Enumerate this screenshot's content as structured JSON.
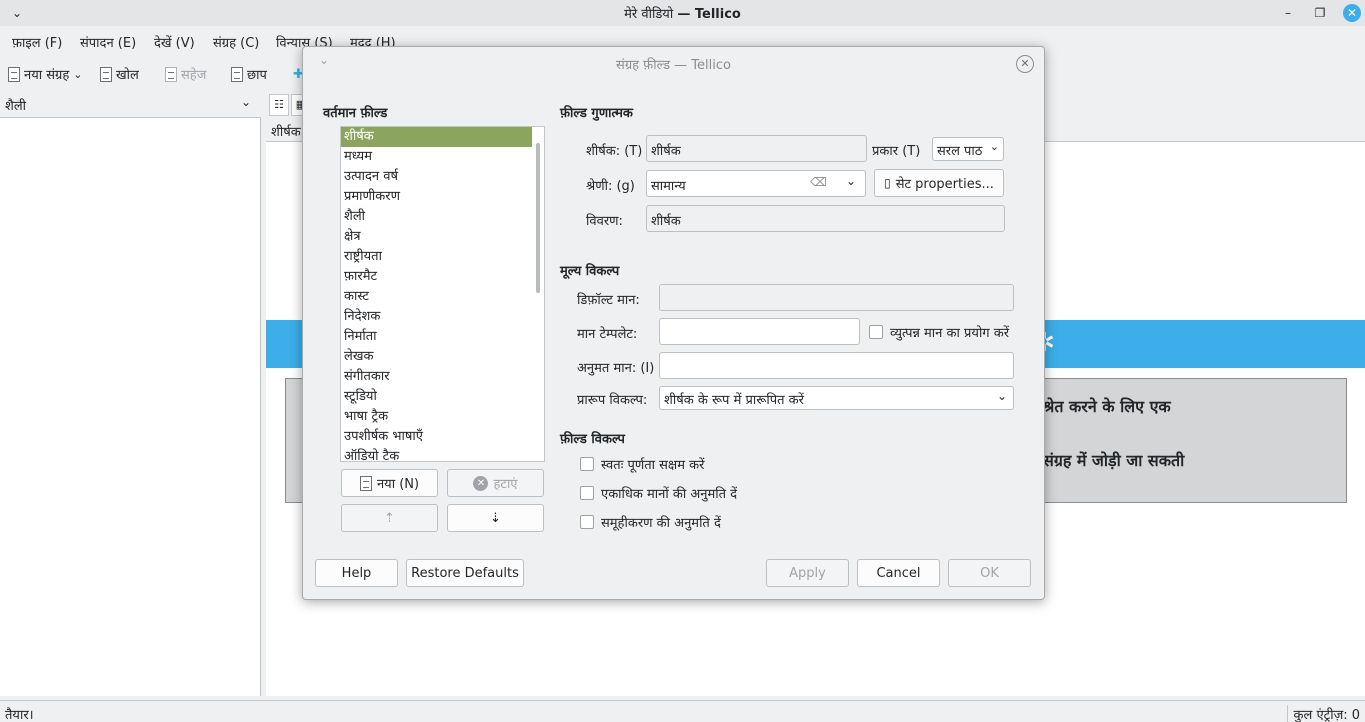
{
  "window": {
    "title_prefix": "मेरे वीडियो",
    "title_app": "— Tellico",
    "minimize_icon": "minimize-icon",
    "maximize_icon": "maximize-icon",
    "close_icon": "close-icon"
  },
  "menu": [
    "फ़ाइल (F)",
    "संपादन (E)",
    "देखें (V)",
    "संग्रह (C)",
    "विन्यास (S)",
    "मदद (H)"
  ],
  "toolbar": {
    "new_collection": "नया संग्रह",
    "open": "खोल",
    "save": "सहेज",
    "print": "छाप"
  },
  "left_pane": {
    "group_combo": "शैली"
  },
  "right_pane": {
    "column_header": "शीर्षक",
    "welcome_line1": "श्रेत करने के लिए एक",
    "welcome_line2": "संग्रह में जोड़ी जा सकती"
  },
  "status": {
    "left": "तैयार।",
    "right": "कुल एंट्रीज़: 0"
  },
  "dialog": {
    "title": "संग्रह फ़ील्ड — Tellico",
    "current_fields_heading": "वर्तमान फ़ील्ड",
    "fields": [
      "शीर्षक",
      "मध्यम",
      "उत्पादन वर्ष",
      "प्रमाणीकरण",
      "शैली",
      "क्षेत्र",
      "राष्ट्रीयता",
      "फ़ारमैट",
      "कास्ट",
      "निदेशक",
      "निर्माता",
      "लेखक",
      "संगीतकार",
      "स्टूडियो",
      "भाषा ट्रैक",
      "उपशीर्षक भाषाएँ",
      "ऑडियो टैक"
    ],
    "selected_field": "शीर्षक",
    "new_button": "नया (N)",
    "delete_button": "हटाएं",
    "attributes_heading": "फ़ील्ड गुणात्मक",
    "title_label": "शीर्षक: (T)",
    "title_value": "शीर्षक",
    "type_label": "प्रकार (T)",
    "type_value": "सरल पाठ",
    "category_label": "श्रेणी: (g)",
    "category_value": "सामान्य",
    "set_properties": "सेट properties...",
    "description_label": "विवरण:",
    "description_value": "शीर्षक",
    "value_options_heading": "मूल्य विकल्प",
    "default_label": "डिफ़ॉल्ट मान:",
    "default_value": "",
    "template_label": "मान टेम्पलेट:",
    "template_value": "",
    "derived_checkbox": "व्युत्पन्न मान का प्रयोग करें",
    "allowed_label": "अनुमत मान: (I)",
    "allowed_value": "",
    "format_label": "प्रारूप विकल्प:",
    "format_value": "शीर्षक के रूप में प्रारूपित करें",
    "field_options_heading": "फ़ील्ड विकल्प",
    "opt_autocomplete": "स्वतः पूर्णता सक्षम करें",
    "opt_multiple": "एकाधिक मानों की अनुमति दें",
    "opt_grouping": "समूहीकरण की अनुमति दें",
    "help_button": "Help",
    "restore_button": "Restore Defaults",
    "apply_button": "Apply",
    "cancel_button": "Cancel",
    "ok_button": "OK"
  }
}
